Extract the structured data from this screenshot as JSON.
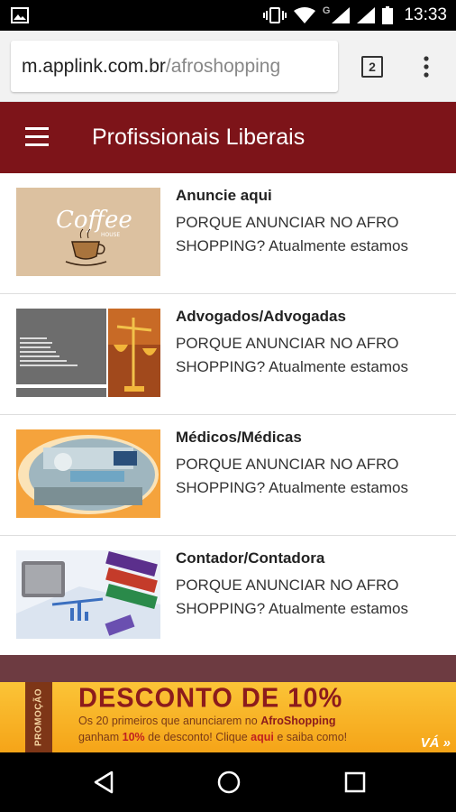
{
  "status_bar": {
    "time": "13:33",
    "network_letter": "G",
    "icons": [
      "image-icon",
      "vibrate-icon",
      "wifi-icon",
      "signal-icon",
      "signal-icon",
      "battery-icon"
    ]
  },
  "browser": {
    "url_host": "m.applink.com.br",
    "url_path": "/afroshopping",
    "tab_count": "2",
    "menu_icon": "more-vert-icon"
  },
  "header": {
    "title": "Profissionais Liberais",
    "menu_icon": "hamburger-icon",
    "background_color": "#7d1419"
  },
  "items": [
    {
      "title": "Anuncie aqui",
      "desc_line1": "PORQUE ANUNCIAR NO AFRO",
      "desc_line2": "SHOPPING? Atualmente estamos",
      "thumb_label": "Coffee",
      "thumb_sub": "HOUSE"
    },
    {
      "title": "Advogados/Advogadas",
      "desc_line1": "PORQUE ANUNCIAR NO AFRO",
      "desc_line2": "SHOPPING? Atualmente estamos"
    },
    {
      "title": "Médicos/Médicas",
      "desc_line1": "PORQUE ANUNCIAR NO AFRO",
      "desc_line2": "SHOPPING? Atualmente estamos"
    },
    {
      "title": "Contador/Contadora",
      "desc_line1": "PORQUE ANUNCIAR NO AFRO",
      "desc_line2": "SHOPPING? Atualmente estamos"
    }
  ],
  "banner": {
    "tag": "PROMOÇÃO",
    "title": "DESCONTO DE 10%",
    "line1_prefix": "Os 20 primeiros que anunciarem no ",
    "line1_brand": "AfroShopping",
    "line2_prefix": "ganham ",
    "line2_pct": "10%",
    "line2_mid": " de desconto! Clique ",
    "line2_link": "aqui",
    "line2_suffix": " e saiba como!",
    "cta": "VÁ »"
  },
  "nav": {
    "icons": [
      "back-icon",
      "home-icon",
      "recents-icon"
    ]
  }
}
